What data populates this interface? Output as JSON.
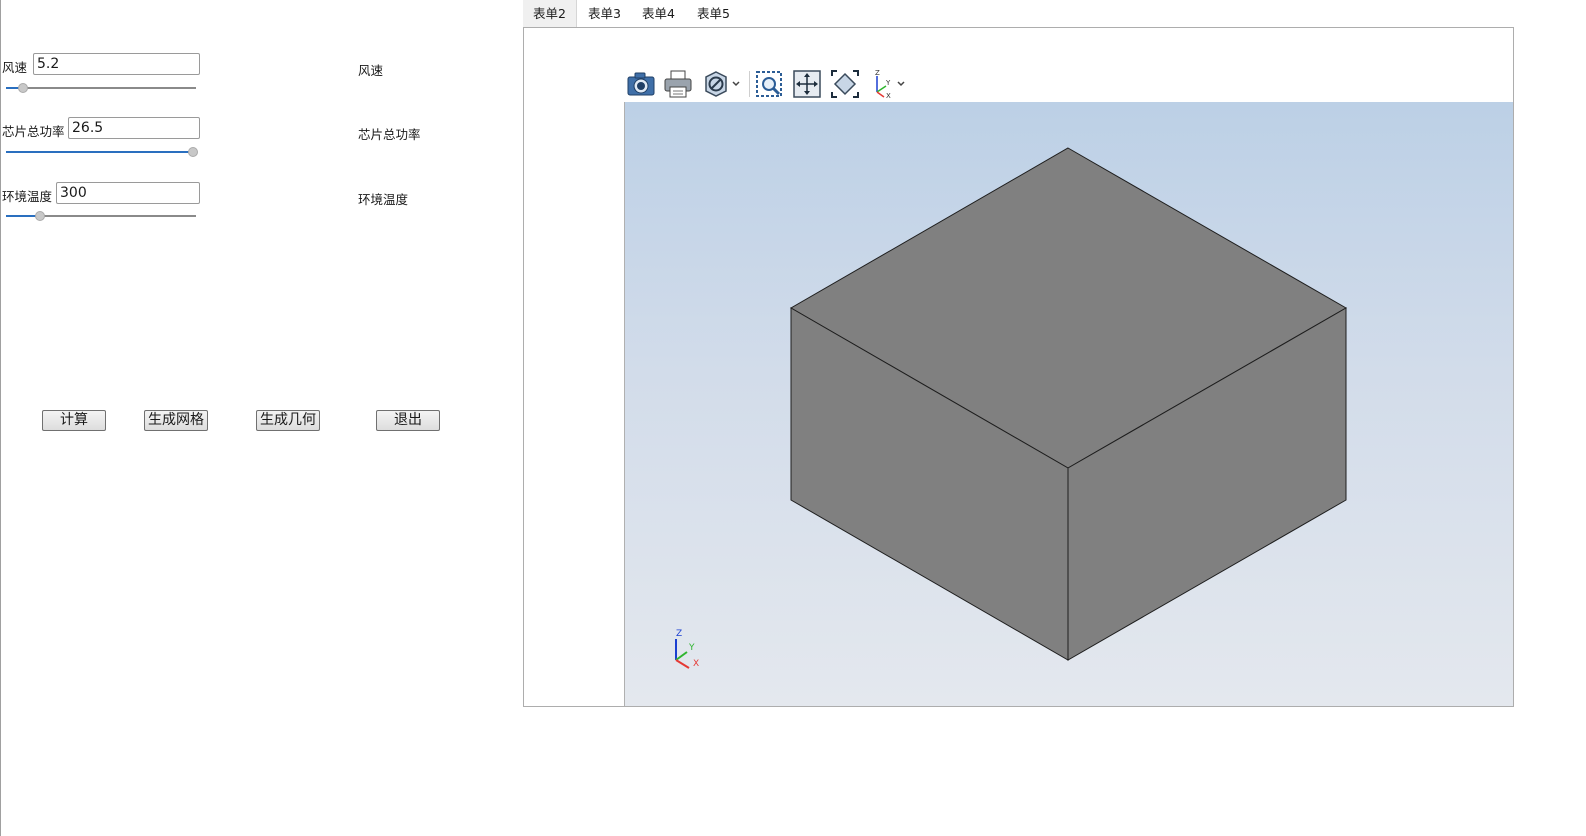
{
  "params": [
    {
      "label": "风速",
      "value": "5.2",
      "slider_fraction": 0.09,
      "side_label": "风速"
    },
    {
      "label": "芯片总功率",
      "value": "26.5",
      "slider_fraction": 0.985,
      "side_label": "芯片总功率"
    },
    {
      "label": "环境温度",
      "value": "300",
      "slider_fraction": 0.18,
      "side_label": "环境温度"
    }
  ],
  "buttons": {
    "compute": "计算",
    "gen_mesh": "生成网格",
    "gen_geometry": "生成几何",
    "exit": "退出"
  },
  "tabs": [
    "表单2",
    "表单3",
    "表单4",
    "表单5"
  ],
  "active_tab": "表单2",
  "toolbar": [
    {
      "icon": "camera-icon"
    },
    {
      "icon": "print-icon"
    },
    {
      "icon": "display-mode-icon"
    },
    {
      "icon": "zoom-box-icon"
    },
    {
      "icon": "pan-icon"
    },
    {
      "icon": "fit-all-icon"
    },
    {
      "icon": "view-axes-icon"
    }
  ],
  "triad": {
    "x": "X",
    "y": "Y",
    "z": "Z"
  },
  "colors": {
    "accent": "#2a6fbf",
    "viewport_top": "#bcd0e6",
    "viewport_bottom": "#e4e8ee",
    "solid": "#808080",
    "axis_x": "#e53935",
    "axis_y": "#2fb52f",
    "axis_z": "#1a3fd1"
  }
}
